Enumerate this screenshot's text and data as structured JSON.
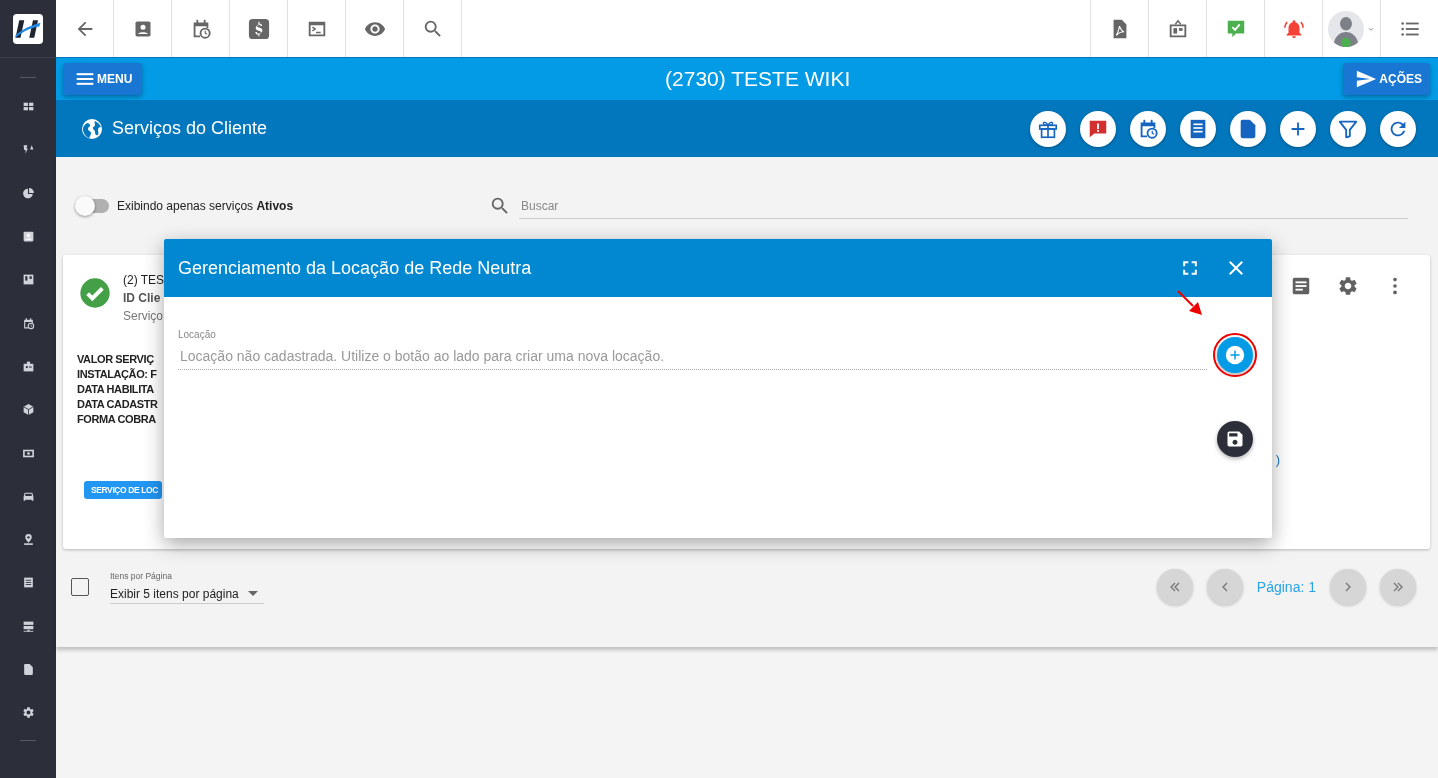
{
  "app_bar": {
    "menu_button": "MENU",
    "title": "(2730) TESTE WIKI",
    "actions_button": "AÇÕES"
  },
  "page_header": {
    "title": "Serviços do Cliente"
  },
  "filter": {
    "toggle": {
      "on": false
    },
    "toggle_label": "Exibindo apenas serviços **Ativos**",
    "search": {
      "placeholder": "Buscar"
    }
  },
  "service_card": {
    "title": "(2) TES",
    "client_id": "ID Clie",
    "subtitle": "Serviço",
    "details": [
      "VALOR SERVIÇ",
      "INSTALAÇÃO: F",
      "DATA HABILITA",
      "DATA CADASTR",
      "FORMA COBRA"
    ],
    "tag": "SERVIÇO DE LOC",
    "link_fragment": ")"
  },
  "dialog": {
    "title": "Gerenciamento da Locação de Rede Neutra",
    "field": {
      "label": "Locação",
      "placeholder": "Locação não cadastrada. Utilize o botão ao lado para criar uma nova locação."
    }
  },
  "pagination": {
    "select_all": {
      "checked": false
    },
    "per_page_label": "Itens por Página",
    "per_page_value": "Exibir 5 itens por página",
    "page": "Página: 1"
  }
}
